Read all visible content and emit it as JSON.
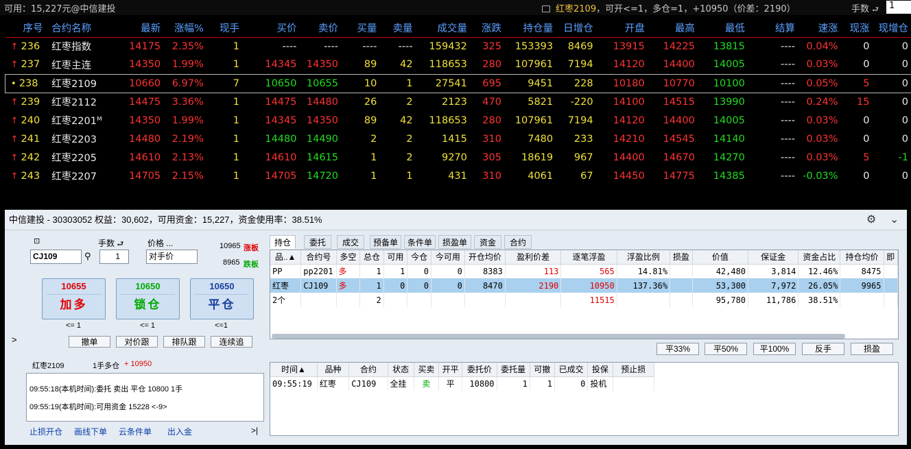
{
  "topbar": {
    "available": "可用：15,227元@中信建投",
    "contract_name": "红枣2109",
    "contract_info": "，可开<=1，多仓=1，+10950（价差：2190）",
    "lots_label": "手数",
    "lots_value": "1"
  },
  "quote": {
    "headers": [
      "序号",
      "合约名称",
      "最新",
      "涨幅%",
      "现手",
      "买价",
      "卖价",
      "买量",
      "卖量",
      "成交量",
      "涨跌",
      "持仓量",
      "日增仓",
      "开盘",
      "最高",
      "最低",
      "结算",
      "速涨",
      "现涨",
      "现增仓"
    ],
    "rows": [
      [
        "236",
        "红枣指数",
        "14175",
        "2.35%",
        "1",
        "----",
        "----",
        "----",
        "----",
        "159432",
        "325",
        "153393",
        "8469",
        "13915",
        "14225",
        "13815",
        "----",
        "0.04%",
        "0",
        "0"
      ],
      [
        "237",
        "红枣主连",
        "14350",
        "1.99%",
        "1",
        "14345",
        "14350",
        "89",
        "42",
        "118653",
        "280",
        "107961",
        "7194",
        "14120",
        "14400",
        "14005",
        "----",
        "0.03%",
        "0",
        "0"
      ],
      [
        "238",
        "红枣2109",
        "10660",
        "6.97%",
        "7",
        "10650",
        "10655",
        "10",
        "1",
        "27541",
        "695",
        "9451",
        "228",
        "10180",
        "10770",
        "10100",
        "----",
        "0.05%",
        "5",
        "0"
      ],
      [
        "239",
        "红枣2112",
        "14475",
        "3.36%",
        "1",
        "14475",
        "14480",
        "26",
        "2",
        "2123",
        "470",
        "5821",
        "-220",
        "14100",
        "14515",
        "13990",
        "----",
        "0.24%",
        "15",
        "0"
      ],
      [
        "240",
        "红枣2201ᴹ",
        "14350",
        "1.99%",
        "1",
        "14345",
        "14350",
        "89",
        "42",
        "118653",
        "280",
        "107961",
        "7194",
        "14120",
        "14400",
        "14005",
        "----",
        "0.03%",
        "0",
        "0"
      ],
      [
        "241",
        "红枣2203",
        "14480",
        "2.19%",
        "1",
        "14480",
        "14490",
        "2",
        "2",
        "1415",
        "310",
        "7480",
        "233",
        "14210",
        "14545",
        "14140",
        "----",
        "0.03%",
        "0",
        "0"
      ],
      [
        "242",
        "红枣2205",
        "14610",
        "2.13%",
        "1",
        "14610",
        "14615",
        "1",
        "2",
        "9270",
        "305",
        "18619",
        "967",
        "14400",
        "14670",
        "14270",
        "----",
        "0.03%",
        "5",
        "-1"
      ],
      [
        "243",
        "红枣2207",
        "14705",
        "2.15%",
        "1",
        "14705",
        "14720",
        "1",
        "1",
        "431",
        "310",
        "4061",
        "67",
        "14450",
        "14775",
        "14385",
        "----",
        "-0.03%",
        "0",
        "0"
      ]
    ]
  },
  "panel": {
    "title": "中信建投 - 30303052 权益：30,602，可用资金：15,227，资金使用率：38.51%",
    "order": {
      "lots_label": "手数",
      "price_label": "价格 ...",
      "contract_input": "CJ109",
      "lots_input": "1",
      "price_input": "对手价",
      "limit_up": "10965",
      "limit_up_label": "涨板",
      "limit_down": "8965",
      "limit_down_label": "跌板",
      "btn_add": {
        "price": "10655",
        "label": "加多"
      },
      "btn_lock": {
        "price": "10650",
        "label": "锁仓"
      },
      "btn_close": {
        "price": "10650",
        "label": "平仓"
      },
      "sub1": "<= 1",
      "sub2": "<= 1",
      "sub3": "<=1",
      "cancel": "撤单",
      "follow_opp": "对价跟",
      "follow_queue": "排队跟",
      "continuous": "连续追",
      "pos_contract": "红枣2109",
      "pos_desc": "1手多仓",
      "pos_pnl": "+ 10950",
      "log": [
        "09:55:18(本机时间):委托 卖出 平仓 10800 1手",
        "09:55:19(本机时间):可用资金 15228 <-9>"
      ],
      "links": [
        "止损开仓",
        "画线下单",
        "云条件单",
        "出入金"
      ],
      "expand": ">",
      "collapse": ">|"
    },
    "tabs": [
      "持仓",
      "委托",
      "成交",
      "预备单",
      "条件单",
      "损盈单",
      "资金",
      "合约"
    ],
    "pos_headers": [
      "品..▲",
      "合约号",
      "多空",
      "总仓",
      "可用",
      "今仓",
      "今可用",
      "开仓均价",
      "盈利价差",
      "逐笔浮盈",
      "浮盈比例",
      "损盈",
      "价值",
      "保证金",
      "资金占比",
      "持仓均价",
      "即"
    ],
    "pos_rows": [
      [
        "PP",
        "pp2201",
        "多",
        "1",
        "1",
        "0",
        "0",
        "8383",
        "113",
        "565",
        "14.81%",
        "",
        "42,480",
        "3,814",
        "12.46%",
        "8475",
        ""
      ],
      [
        "红枣",
        "CJ109",
        "多",
        "1",
        "0",
        "0",
        "0",
        "8470",
        "2190",
        "10950",
        "137.36%",
        "",
        "53,300",
        "7,972",
        "26.05%",
        "9965",
        ""
      ],
      [
        "2个",
        "",
        "",
        "2",
        "",
        "",
        "",
        "",
        "",
        "11515",
        "",
        "",
        "95,780",
        "11,786",
        "38.51%",
        "",
        ""
      ]
    ],
    "action_buttons": [
      "平33%",
      "平50%",
      "平100%",
      "反手",
      "损盈"
    ],
    "ord_headers": [
      "时间▲",
      "品种",
      "合约",
      "状态",
      "买卖",
      "开平",
      "委托价",
      "委托量",
      "可撤",
      "已成交",
      "投保",
      "预止损"
    ],
    "ord_rows": [
      [
        "09:55:19",
        "红枣",
        "CJ109",
        "全挂",
        "卖",
        "平",
        "10800",
        "1",
        "1",
        "0",
        "投机",
        ""
      ]
    ]
  },
  "colors": {
    "up": "#ff3333",
    "down": "#22dd22",
    "header": "#5aa0ff",
    "volume": "#f2e23c",
    "highlight": "#a9d0ee"
  }
}
